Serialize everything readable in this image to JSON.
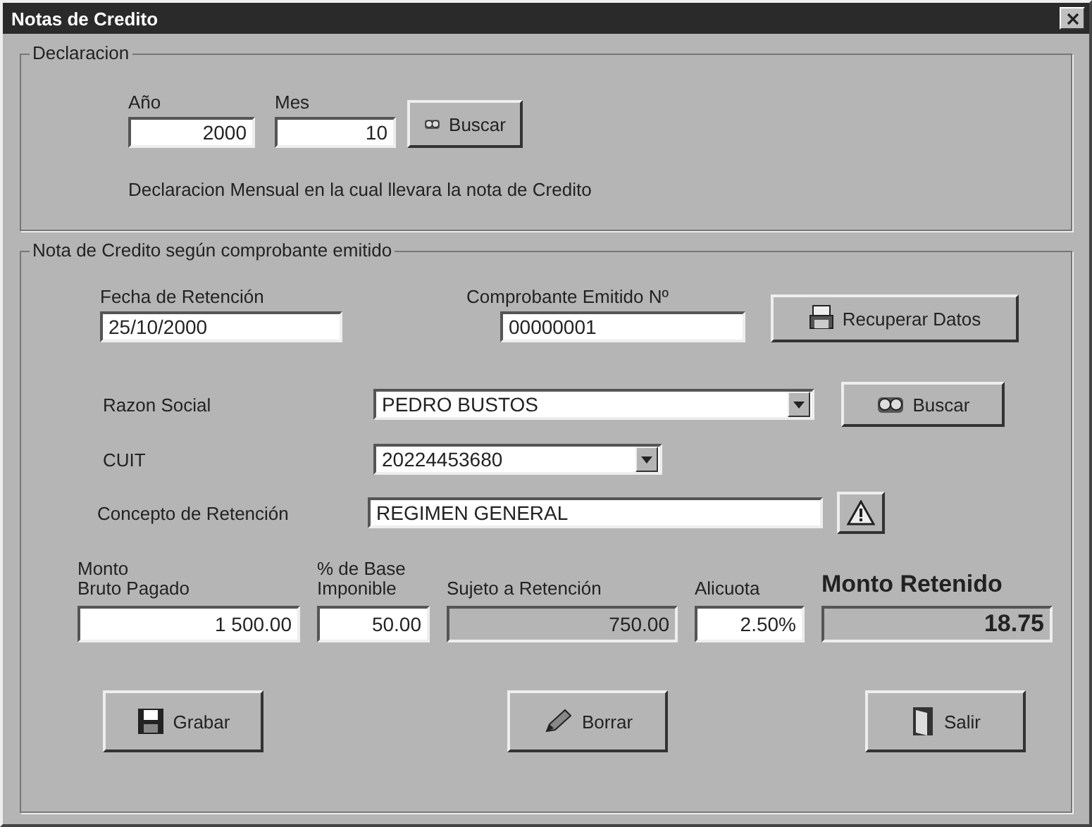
{
  "window": {
    "title": "Notas de Credito"
  },
  "declaracion": {
    "legend": "Declaracion",
    "fields": [
      {
        "label": "Año",
        "value": "2000"
      },
      {
        "label": "Mes",
        "value": "10"
      }
    ],
    "search_button": "Buscar",
    "note": "Declaracion Mensual en la cual llevara la nota de Credito"
  },
  "nota": {
    "legend": "Nota de Credito según comprobante emitido",
    "fecha": {
      "label": "Fecha de Retención",
      "value": "25/10/2000"
    },
    "comprobante": {
      "label": "Comprobante Emitido Nº",
      "value": "00000001"
    },
    "recuperar_button": "Recuperar Datos",
    "rows": [
      {
        "label": "Razon Social",
        "value": "PEDRO BUSTOS",
        "kind": "combo",
        "button": "Buscar"
      },
      {
        "label": "CUIT",
        "value": "20224453680",
        "kind": "combo"
      },
      {
        "label": "Concepto de Retención",
        "value": "REGIMEN GENERAL",
        "kind": "lookup"
      }
    ],
    "amounts": [
      {
        "label": "Monto\nBruto Pagado",
        "value": "1 500.00",
        "disabled": false
      },
      {
        "label": "% de Base\nImponible",
        "value": "50.00",
        "disabled": false
      },
      {
        "label": "Sujeto a Retención",
        "value": "750.00",
        "disabled": true
      },
      {
        "label": "Alicuota",
        "value": "2.50%",
        "disabled": false
      },
      {
        "label": "Monto Retenido",
        "value": "18.75",
        "disabled": true,
        "kind": "total"
      }
    ]
  },
  "buttons": [
    {
      "label": "Grabar"
    },
    {
      "label": "Borrar"
    },
    {
      "label": "Salir"
    }
  ]
}
